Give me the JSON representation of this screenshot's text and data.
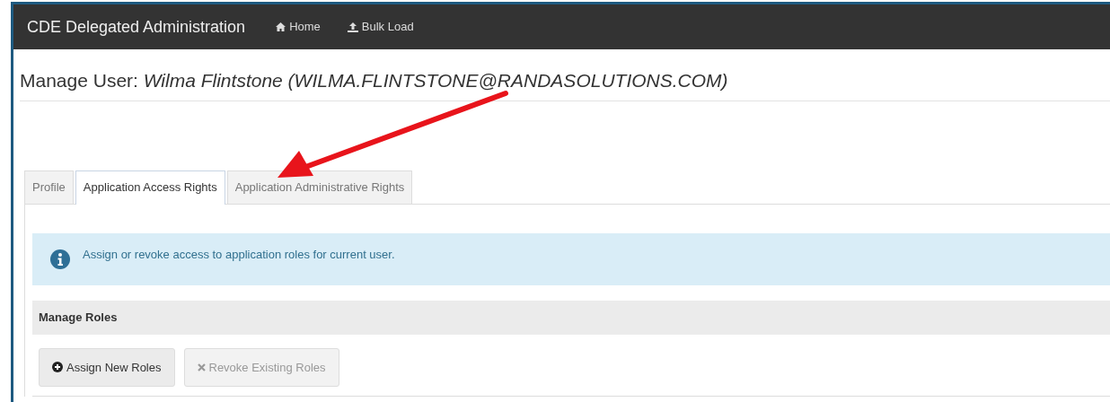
{
  "navbar": {
    "brand": "CDE Delegated Administration",
    "links": [
      {
        "label": "Home"
      },
      {
        "label": "Bulk Load"
      }
    ]
  },
  "page_title": "Manage User: *Wilma Flintstone (WILMA.FLINTSTONE@RANDASOLUTIONS.COM)*",
  "tabs": [
    {
      "label": "Profile",
      "selected": false
    },
    {
      "label": "Application Access Rights",
      "selected": true
    },
    {
      "label": "Application Administrative Rights",
      "selected": false
    }
  ],
  "alert": {
    "text": "Assign or revoke access to application roles for current user."
  },
  "panel": {
    "title": "Manage Roles",
    "buttons": [
      {
        "label": "Assign New Roles",
        "disabled": false
      },
      {
        "label": "Revoke Existing Roles",
        "disabled": true
      }
    ]
  }
}
